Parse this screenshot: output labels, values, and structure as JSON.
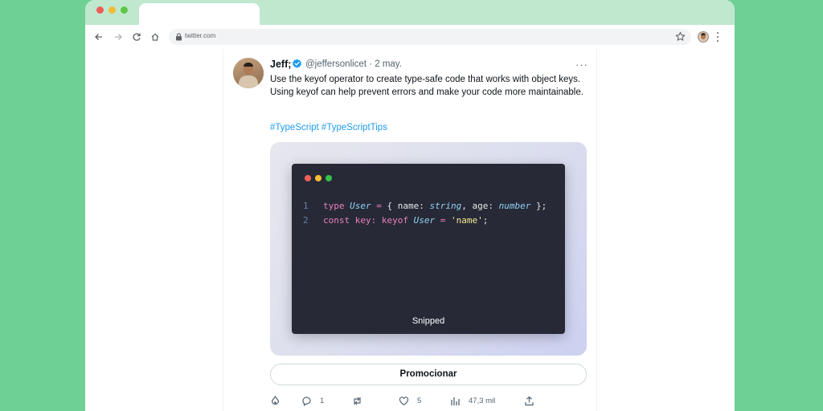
{
  "browser": {
    "url": "twitter.com"
  },
  "tweet": {
    "author_name": "Jeff;",
    "handle_date": "@jeffersonlicet · 2 may.",
    "more_label": "···",
    "text": "Use the keyof operator to create type-safe code that works with object keys. Using keyof can help prevent errors and make your code more maintainable.",
    "hashtags": "#TypeScript #TypeScriptTips",
    "media": {
      "code_lines": [
        {
          "number": "1",
          "tokens": [
            "type",
            "User",
            "=",
            "{ name:",
            "string",
            ", age:",
            "number",
            "};"
          ]
        },
        {
          "number": "2",
          "tokens": [
            "const key:",
            "keyof",
            "User",
            "=",
            "'name'",
            ";"
          ]
        }
      ],
      "caption": "Snipped"
    },
    "promote_label": "Promocionar",
    "stats": {
      "replies": "1",
      "likes": "5",
      "views": "47,3 mil"
    }
  },
  "colors": {
    "page_background": "#6fd094",
    "link": "#1d9bf0",
    "code_background": "#272a36"
  }
}
